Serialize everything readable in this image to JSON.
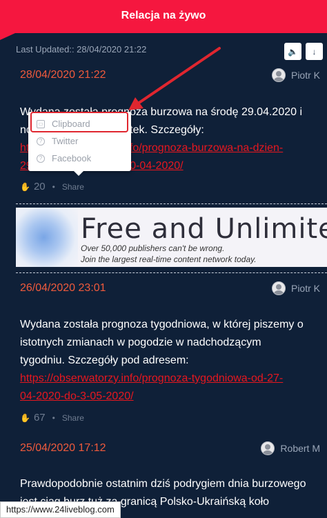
{
  "header": {
    "title": "Relacja na żywo"
  },
  "toolbar": {
    "last_updated": "Last Updated:: 28/04/2020 21:22",
    "sound_icon": "speaker-icon",
    "scroll_icon": "arrow-down-icon"
  },
  "posts": [
    {
      "date": "28/04/2020 21:22",
      "author": "Piotr K",
      "text_line1": "Wydana została prognoza burzowa na środę 29.04.2020 i",
      "text_line2": "noc ze środy na czwartek. Szczegóły:",
      "link_line1": "https://obserwatorzy.info/prognoza-burzowa-na-dzien-",
      "link_line2": "29-04-2020-i-noc-29-30-04-2020/",
      "likes": "20",
      "share": "Share"
    },
    {
      "date": "26/04/2020 23:01",
      "author": "Piotr K",
      "text_line1": "Wydana została prognoza tygodniowa, w której piszemy o",
      "text_line2": "istotnych zmianach w pogodzie w nadchodzącym",
      "text_line3": "tygodniu. Szczegóły pod adresem:",
      "link_line1": "https://obserwatorzy.info/prognoza-tygodniowa-od-27-",
      "link_line2": "04-2020-do-3-05-2020/",
      "likes": "67",
      "share": "Share"
    },
    {
      "date": "25/04/2020 17:12",
      "author": "Robert M",
      "text_line1": "Prawdopodobnie ostatnim dziś podrygiem dnia burzowego",
      "text_line2": "jest ciąg burz tuż za granicą Polsko-Ukraińską koło"
    }
  ],
  "ad": {
    "headline": "Free and Unlimited",
    "line1": "Over 50,000 publishers can't be wrong.",
    "line2": "Join the largest real-time content network today."
  },
  "share_menu": {
    "items": [
      {
        "label": "Clipboard",
        "icon": "clipboard-icon"
      },
      {
        "label": "Twitter",
        "icon": "twitter-icon"
      },
      {
        "label": "Facebook",
        "icon": "facebook-icon"
      }
    ]
  },
  "status_bar": {
    "url": "https://www.24liveblog.com"
  },
  "colors": {
    "header": "#f5173f",
    "background": "#0f2038",
    "date": "#f05a3c",
    "link": "#e8171f",
    "annotation": "#e0262f"
  }
}
